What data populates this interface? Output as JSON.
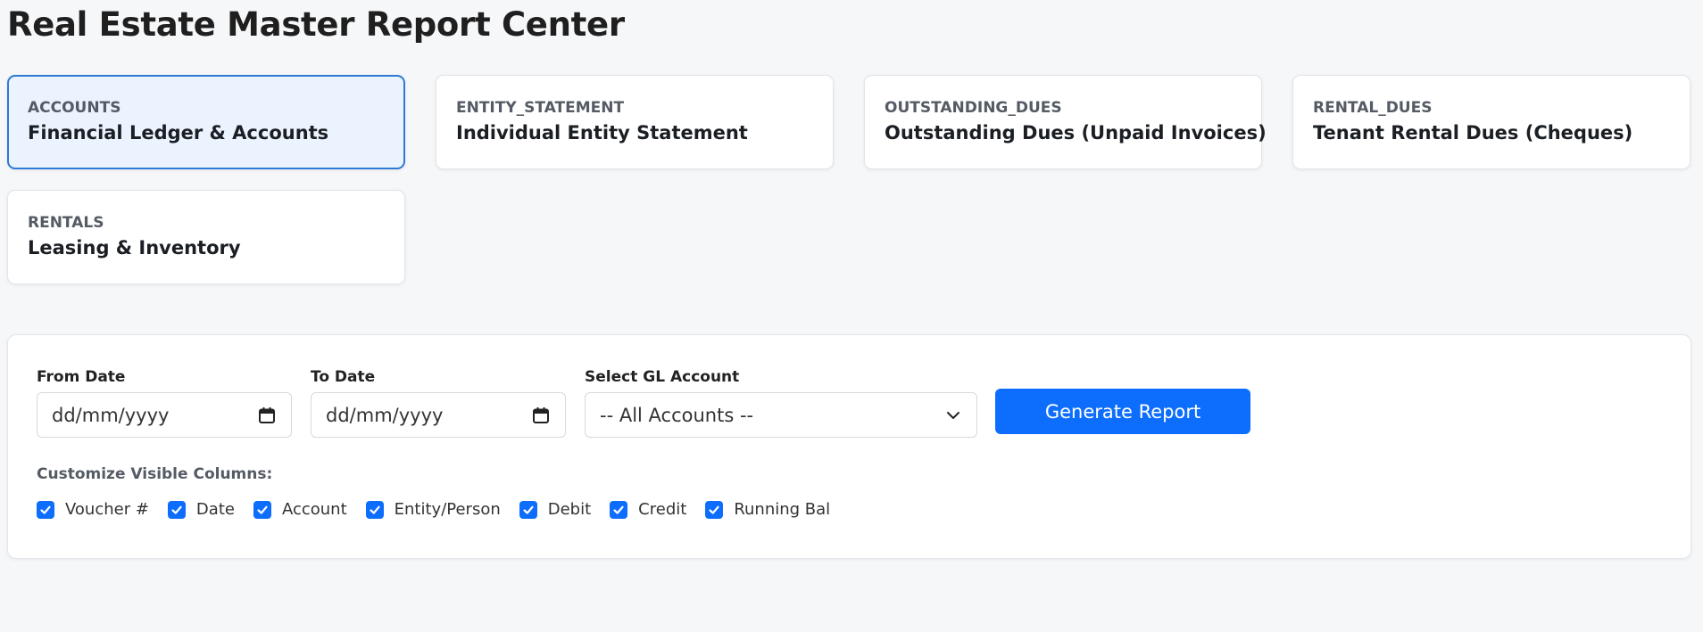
{
  "page_title": "Real Estate Master Report Center",
  "report_cards": [
    {
      "code": "ACCOUNTS",
      "name": "Financial Ledger & Accounts",
      "active": true
    },
    {
      "code": "ENTITY_STATEMENT",
      "name": "Individual Entity Statement",
      "active": false
    },
    {
      "code": "OUTSTANDING_DUES",
      "name": "Outstanding Dues (Unpaid Invoices)",
      "active": false
    },
    {
      "code": "RENTAL_DUES",
      "name": "Tenant Rental Dues (Cheques)",
      "active": false
    },
    {
      "code": "RENTALS",
      "name": "Leasing & Inventory",
      "active": false
    }
  ],
  "filters": {
    "from_date": {
      "label": "From Date",
      "value": "dd/mm/yyyy",
      "icon": "calendar-icon"
    },
    "to_date": {
      "label": "To Date",
      "value": "dd/mm/yyyy",
      "icon": "calendar-icon"
    },
    "gl_account": {
      "label": "Select GL Account",
      "selected": "-- All Accounts --",
      "icon": "chevron-down-icon"
    },
    "generate_button": "Generate Report"
  },
  "columns": {
    "label": "Customize Visible Columns:",
    "items": [
      {
        "label": "Voucher #",
        "checked": true
      },
      {
        "label": "Date",
        "checked": true
      },
      {
        "label": "Account",
        "checked": true
      },
      {
        "label": "Entity/Person",
        "checked": true
      },
      {
        "label": "Debit",
        "checked": true
      },
      {
        "label": "Credit",
        "checked": true
      },
      {
        "label": "Running Bal",
        "checked": true
      }
    ]
  },
  "colors": {
    "accent": "#0d6efd",
    "active_card_bg": "#eaf3fe",
    "active_card_border": "#2e7ad6",
    "page_bg": "#f6f7f9"
  }
}
